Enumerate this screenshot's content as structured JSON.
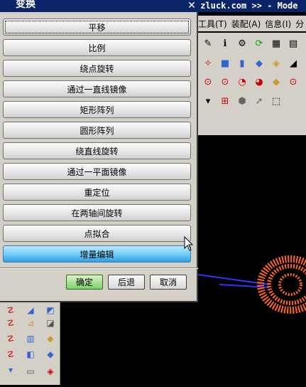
{
  "dialog": {
    "title": "变换",
    "options": [
      {
        "label": "平移"
      },
      {
        "label": "比例"
      },
      {
        "label": "绕点旋转"
      },
      {
        "label": "通过一直线镜像"
      },
      {
        "label": "矩形阵列"
      },
      {
        "label": "圆形阵列"
      },
      {
        "label": "绕直线旋转"
      },
      {
        "label": "通过一平面镜像"
      },
      {
        "label": "重定位"
      },
      {
        "label": "在两轴间旋转"
      },
      {
        "label": "点拟合"
      },
      {
        "label": "增量编辑"
      }
    ],
    "ok_label": "确定",
    "back_label": "后退",
    "cancel_label": "取消"
  },
  "app": {
    "title": "zluck.com >> - Mode",
    "menu": [
      "工具(T)",
      "装配(A)",
      "信息(I)",
      "分"
    ]
  }
}
